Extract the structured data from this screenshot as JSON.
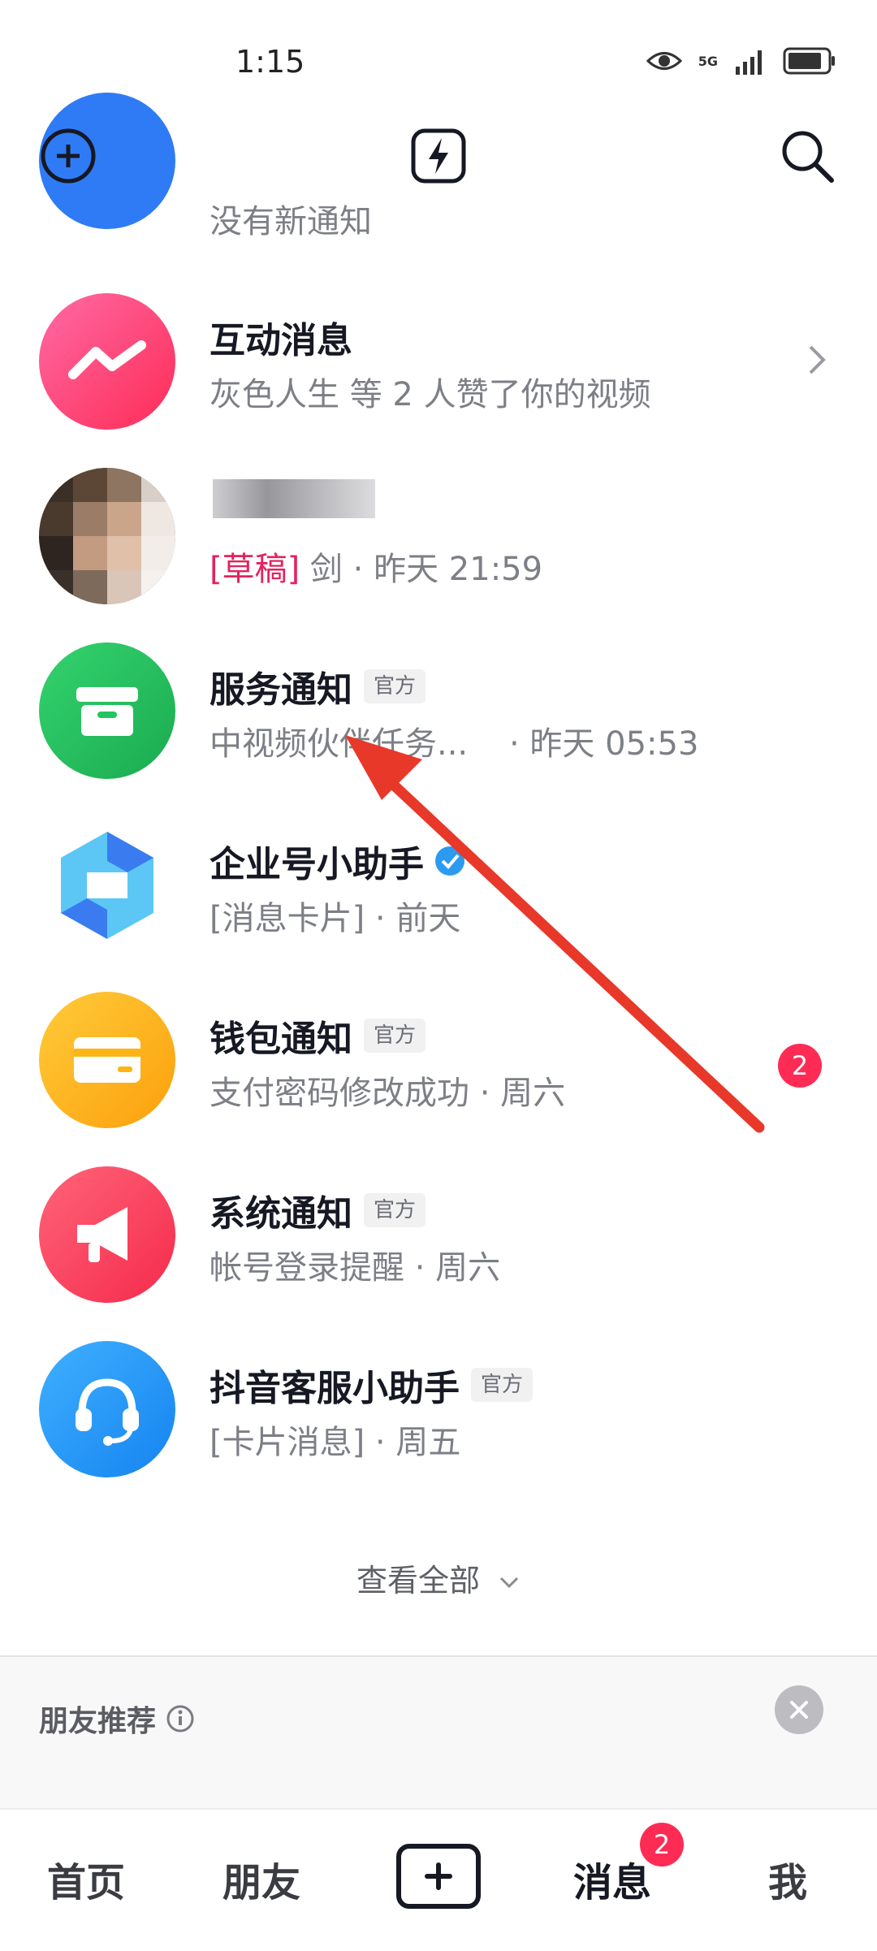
{
  "status_bar": {
    "time": "1:15",
    "network": "5G"
  },
  "top_bar": {
    "add_icon": "plus-circle-icon",
    "flash_icon": "lightning-icon",
    "search_icon": "search-icon"
  },
  "messages": [
    {
      "title": "",
      "subtitle": "没有新通知",
      "color": "#2f7bf6"
    },
    {
      "title": "互动消息",
      "subtitle": "灰色人生 等 2 人赞了你的视频",
      "color": "#fe3f7b"
    },
    {
      "title": "",
      "draft": "[草稿]",
      "subtitle": " 剑 · 昨天 21:59"
    },
    {
      "title": "服务通知",
      "badge": "官方",
      "subtitle": "中视频伙伴任务...    · 昨天 05:53",
      "color": "#23c55e"
    },
    {
      "title": "企业号小助手",
      "subtitle": "[消息卡片] · 前天"
    },
    {
      "title": "钱包通知",
      "badge": "官方",
      "subtitle": "支付密码修改成功 · 周六",
      "unread": "2",
      "color": "#fdb515"
    },
    {
      "title": "系统通知",
      "badge": "官方",
      "subtitle": "帐号登录提醒 · 周六",
      "color": "#fa3e5c"
    },
    {
      "title": "抖音客服小助手",
      "badge": "官方",
      "subtitle": "[卡片消息] · 周五",
      "color": "#2196f3"
    }
  ],
  "view_all": "查看全部",
  "friends_section": {
    "title": "朋友推荐"
  },
  "bottom_nav": {
    "home": "首页",
    "friends": "朋友",
    "messages": "消息",
    "messages_badge": "2",
    "me": "我"
  },
  "colors": {
    "accent": "#fe2c55",
    "annotation": "#e8382a"
  }
}
